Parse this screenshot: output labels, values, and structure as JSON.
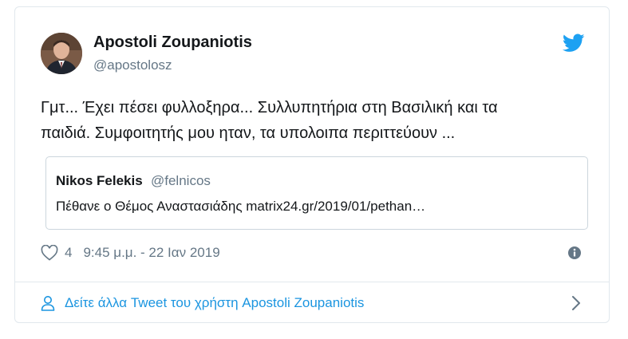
{
  "author": {
    "name": "Apostoli Zoupaniotis",
    "handle": "@apostolosz"
  },
  "tweet": {
    "text_line1": "Γμτ... Έχει πέσει φυλλοξηρα... Συλλυπητήρια στη Βασιλική και τα",
    "text_line2": "παιδιά. Συμφοιτητής μου ηταν, τα υπολοιπα περιττεύουν ..."
  },
  "quoted": {
    "name": "Nikos Felekis",
    "handle": "@felnicos",
    "text": "Πέθανε ο Θέμος Αναστασιάδης  matrix24.gr/2019/01/pethan…"
  },
  "meta": {
    "likes": "4",
    "timestamp": "9:45 μ.μ. - 22 Ιαν 2019"
  },
  "footer": {
    "more_tweets_label": "Δείτε άλλα Tweet του χρήστη Apostoli Zoupaniotis"
  },
  "colors": {
    "accent": "#1b95e0",
    "twitter_blue": "#1da1f2",
    "muted": "#657786",
    "border": "#e1e8ed"
  },
  "icons": [
    "twitter-bird-icon",
    "heart-icon",
    "info-icon",
    "person-icon",
    "chevron-right-icon"
  ]
}
